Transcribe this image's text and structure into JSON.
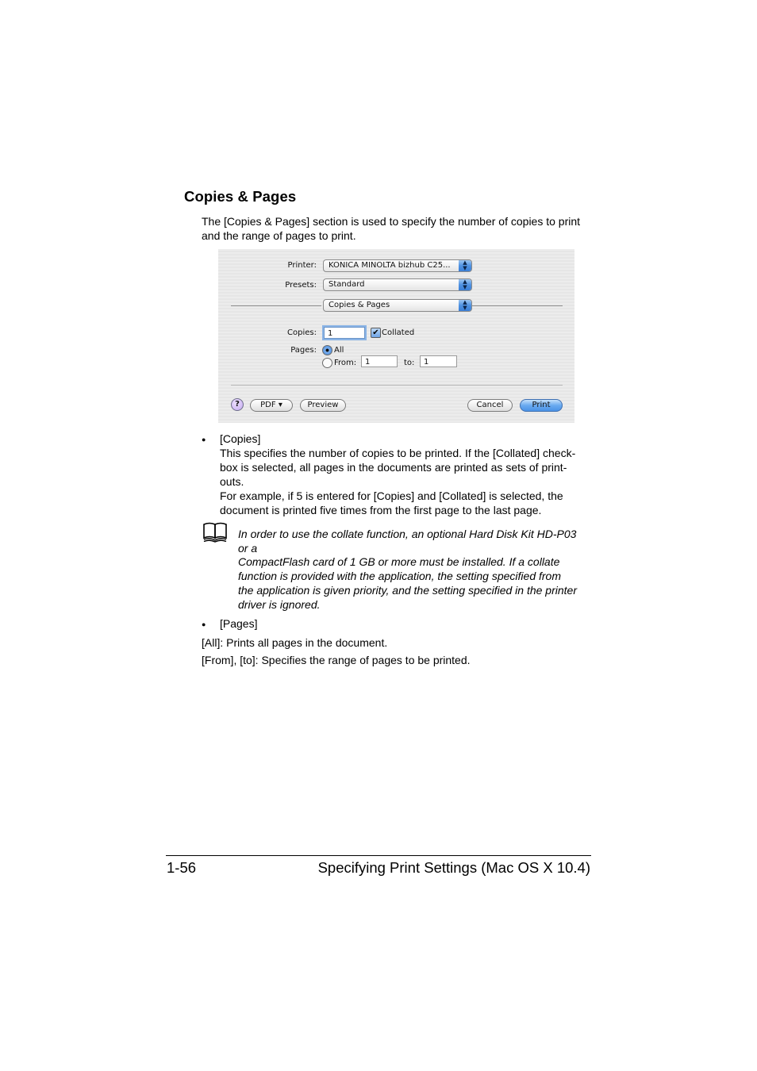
{
  "section": {
    "title": "Copies & Pages",
    "intro": [
      "The [Copies & Pages] section is used to specify the number of copies to print",
      "and the range of pages to print."
    ]
  },
  "dialog": {
    "printer_label": "Printer:",
    "printer_value": "KONICA MINOLTA bizhub C25...",
    "presets_label": "Presets:",
    "presets_value": "Standard",
    "panel_value": "Copies & Pages",
    "stepper_glyph": "▲\n▼",
    "copies_label": "Copies:",
    "copies_value": "1",
    "collated_label": "Collated",
    "collated_checked": true,
    "check_glyph": "✔",
    "pages_label": "Pages:",
    "all_label": "All",
    "all_selected": true,
    "from_label": "From:",
    "from_value": "1",
    "to_label": "to:",
    "to_value": "1",
    "help_label": "?",
    "pdf_label": "PDF ▾",
    "preview_label": "Preview",
    "cancel_label": "Cancel",
    "print_label": "Print"
  },
  "bullets": {
    "bullet_glyph": "●",
    "copies": {
      "title": "[Copies]",
      "lines": [
        "This specifies the number of copies to be printed. If the [Collated] check-",
        "box is selected, all pages in the documents are printed as sets of print-",
        "outs.",
        "For example, if 5 is entered for [Copies] and [Collated] is selected, the",
        "document is printed five times from the first page to the last page."
      ]
    },
    "pages": {
      "title": "[Pages]"
    }
  },
  "note": {
    "icon": "book-icon",
    "lines": [
      "In order to use the collate function, an optional Hard Disk Kit HD-P03",
      "or a",
      "CompactFlash card of 1 GB or more must be installed. If a collate",
      "function is provided with the application, the setting specified from",
      "the application is given priority, and the setting specified in the printer",
      "driver is ignored."
    ]
  },
  "pages_desc": {
    "all": "[All]: Prints all pages in the document.",
    "from_to": "[From], [to]: Specifies the range of pages to be printed."
  },
  "footer": {
    "page_number": "1-56",
    "chapter": "Specifying Print Settings (Mac OS X 10.4)"
  }
}
